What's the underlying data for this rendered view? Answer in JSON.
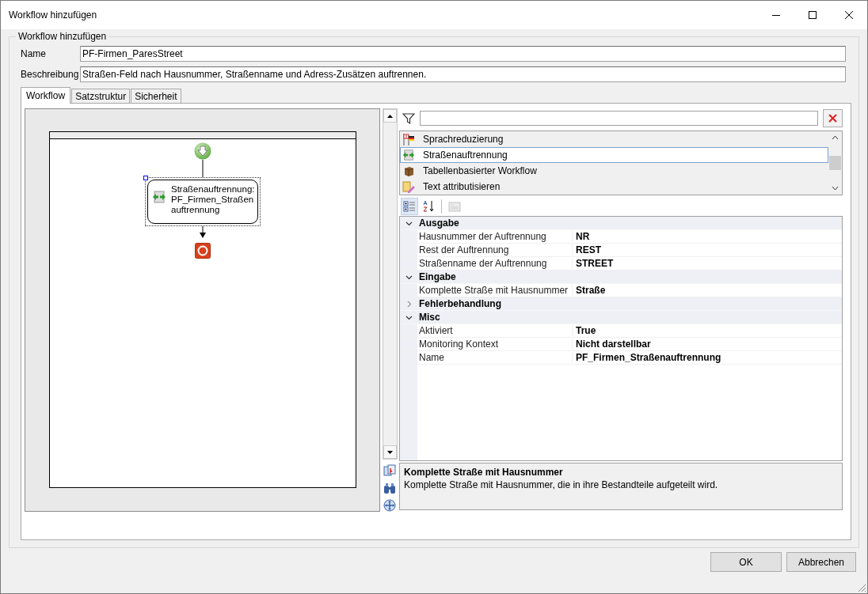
{
  "window": {
    "title": "Workflow hinzufügen"
  },
  "group": {
    "legend": "Workflow hinzufügen"
  },
  "fields": [
    {
      "label": "Name",
      "value": "PF-Firmen_ParesStreet"
    },
    {
      "label": "Beschreibung",
      "value": "Straßen-Feld nach Hausnummer, Straßenname und Adress-Zusätzen auftrennen."
    }
  ],
  "tabs": [
    {
      "label": "Workflow",
      "selected": true
    },
    {
      "label": "Satzstruktur",
      "selected": false
    },
    {
      "label": "Sicherheit",
      "selected": false
    }
  ],
  "designer": {
    "activity": {
      "lines": [
        "Straßenauftrennung:",
        "PF_Firmen_Straßen",
        "auftrennung"
      ],
      "selected": true
    }
  },
  "toolbox": {
    "items": [
      {
        "label": "Sprachreduzierung",
        "kind": "flags",
        "selected": false
      },
      {
        "label": "Straßenauftrennung",
        "kind": "split",
        "selected": true
      },
      {
        "label": "Tabellenbasierter Workflow",
        "kind": "box",
        "selected": false
      },
      {
        "label": "Text attributisieren",
        "kind": "text",
        "selected": false
      }
    ]
  },
  "properties": [
    {
      "name": "Ausgabe",
      "expanded": true,
      "items": [
        {
          "name": "Hausnummer der Auftrennung",
          "value": "NR"
        },
        {
          "name": "Rest der Auftrennung",
          "value": "REST"
        },
        {
          "name": "Straßenname der Auftrennung",
          "value": "STREET"
        }
      ]
    },
    {
      "name": "Eingabe",
      "expanded": true,
      "items": [
        {
          "name": "Komplette Straße mit Hausnummer",
          "value": "Straße"
        }
      ]
    },
    {
      "name": "Fehlerbehandlung",
      "expanded": false
    },
    {
      "name": "Misc",
      "expanded": true,
      "items": [
        {
          "name": "Aktiviert",
          "value": "True"
        },
        {
          "name": "Monitoring Kontext",
          "value": "Nicht darstellbar"
        },
        {
          "name": "Name",
          "value": "PF_Firmen_Straßenauftrennung"
        }
      ]
    }
  ],
  "description": {
    "title": "Komplette Straße mit Hausnummer",
    "text": "Komplette Straße mit Hausnummer, die in ihre Bestandteile aufgeteilt wird."
  },
  "buttons": [
    {
      "label": "OK"
    },
    {
      "label": "Abbrechen"
    }
  ]
}
